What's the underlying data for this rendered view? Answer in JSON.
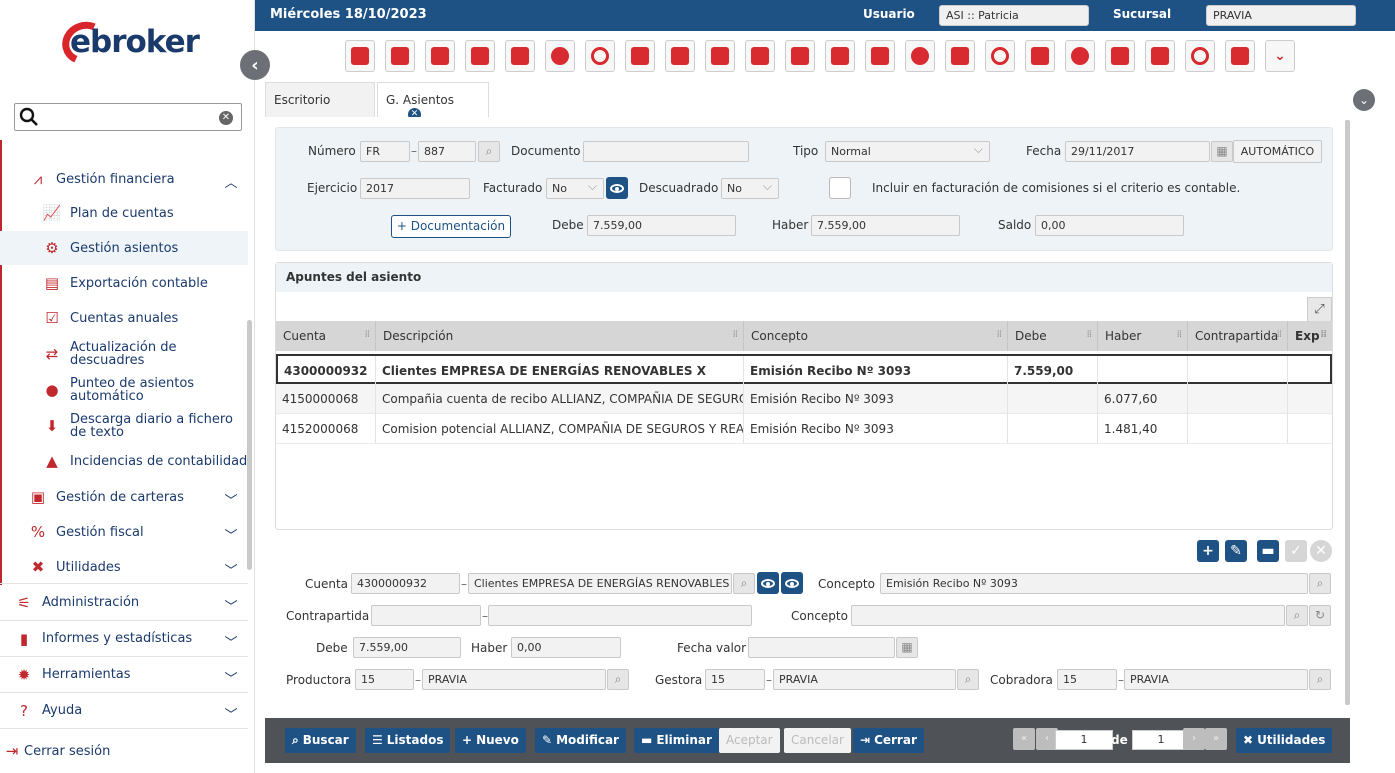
{
  "brand": {
    "logo_text": "ebroker"
  },
  "sidebar": {
    "search_placeholder": "",
    "groups": [
      {
        "label": "Gestión financiera",
        "items": [
          "Plan de cuentas",
          "Gestión asientos",
          "Exportación contable",
          "Cuentas anuales",
          "Actualización de descuadres",
          "Punteo de asientos automático",
          "Descarga diario a fichero de texto",
          "Incidencias de contabilidad"
        ]
      },
      {
        "label": "Gestión de carteras"
      },
      {
        "label": "Gestión fiscal"
      },
      {
        "label": "Utilidades"
      }
    ],
    "top": [
      "Administración",
      "Informes y estadísticas",
      "Herramientas",
      "Ayuda"
    ],
    "logout": "Cerrar sesión"
  },
  "topbar": {
    "date": "Miércoles 18/10/2023",
    "user_label": "Usuario",
    "user_value": "ASI :: Patricia",
    "branch_label": "Sucursal",
    "branch_value": "PRAVIA"
  },
  "tabs": [
    {
      "label": "Escritorio"
    },
    {
      "label": "G. Asientos"
    }
  ],
  "header_form": {
    "numero_label": "Número",
    "numero_serie": "FR",
    "numero_valor": "887",
    "documento_label": "Documento",
    "documento_valor": "",
    "tipo_label": "Tipo",
    "tipo_valor": "Normal",
    "fecha_label": "Fecha",
    "fecha_valor": "29/11/2017",
    "auto_label": "AUTOMÁTICO",
    "ejercicio_label": "Ejercicio",
    "ejercicio_valor": "2017",
    "facturado_label": "Facturado",
    "facturado_valor": "No",
    "descuadrado_label": "Descuadrado",
    "descuadrado_valor": "No",
    "incluir_label": "Incluir en facturación de comisiones si el criterio es contable.",
    "doc_button": "+ Documentación",
    "debe_label": "Debe",
    "debe_valor": "7.559,00",
    "haber_label": "Haber",
    "haber_valor": "7.559,00",
    "saldo_label": "Saldo",
    "saldo_valor": "0,00"
  },
  "apuntes": {
    "title": "Apuntes del asiento",
    "columns": [
      "Cuenta",
      "Descripción",
      "Concepto",
      "Debe",
      "Haber",
      "Contrapartida",
      "Exp"
    ],
    "rows": [
      [
        "4300000932",
        "Clientes EMPRESA DE ENERGÍAS RENOVABLES X",
        "Emisión Recibo Nº 3093",
        "7.559,00",
        "",
        ""
      ],
      [
        "4150000068",
        "Compañia cuenta de recibo ALLIANZ, COMPAÑIA DE SEGUROS",
        "Emisión Recibo Nº 3093",
        "",
        "6.077,60",
        ""
      ],
      [
        "4152000068",
        "Comision potencial ALLIANZ, COMPAÑIA DE SEGUROS Y REASE",
        "Emisión Recibo Nº 3093",
        "",
        "1.481,40",
        ""
      ]
    ]
  },
  "detail": {
    "cuenta_label": "Cuenta",
    "cuenta_valor": "4300000932",
    "cuenta_desc": "Clientes EMPRESA DE ENERGÍAS RENOVABLES",
    "concepto_label": "Concepto",
    "concepto_valor": "Emisión Recibo Nº 3093",
    "contrapartida_label": "Contrapartida",
    "contrapartida_valor": "",
    "contrapartida_desc": "",
    "concepto2_label": "Concepto",
    "concepto2_valor": "",
    "debe_label": "Debe",
    "debe_valor": "7.559,00",
    "haber_label": "Haber",
    "haber_valor": "0,00",
    "fecha_valor_label": "Fecha valor",
    "fecha_valor_valor": "",
    "productora_label": "Productora",
    "productora_cod": "15",
    "productora_nom": "PRAVIA",
    "gestora_label": "Gestora",
    "gestora_cod": "15",
    "gestora_nom": "PRAVIA",
    "cobradora_label": "Cobradora",
    "cobradora_cod": "15",
    "cobradora_nom": "PRAVIA"
  },
  "bottom": {
    "buscar": "Buscar",
    "listados": "Listados",
    "nuevo": "Nuevo",
    "modificar": "Modificar",
    "eliminar": "Eliminar",
    "aceptar": "Aceptar",
    "cancelar": "Cancelar",
    "cerrar": "Cerrar",
    "page": "1",
    "de": "de",
    "total": "1",
    "utilidades": "Utilidades"
  },
  "colors": {
    "navy": "#1e5285",
    "red": "#d72b2f"
  }
}
